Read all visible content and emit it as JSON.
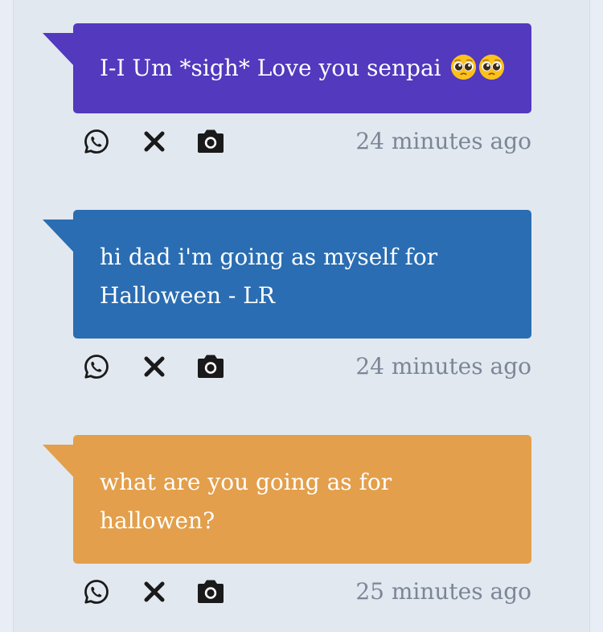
{
  "posts": [
    {
      "text": "I-I Um *sigh* Love you senpai",
      "emoji_count": 2,
      "emoji_icon": "pleading-face-icon",
      "timestamp": "24 minutes ago",
      "color": "#5239be"
    },
    {
      "text": "hi dad i'm going as myself for Halloween - LR",
      "timestamp": "24 minutes ago",
      "color": "#2a6db2"
    },
    {
      "text": "what are you going as for hallowen?",
      "timestamp": "25 minutes ago",
      "color": "#e39f4b"
    }
  ],
  "actions": {
    "icons": [
      "whatsapp-icon",
      "x-icon",
      "camera-icon"
    ]
  },
  "colors": {
    "background": "#e2e8f0",
    "timestamp": "#7b8696",
    "icon": "#1a1a1a"
  }
}
